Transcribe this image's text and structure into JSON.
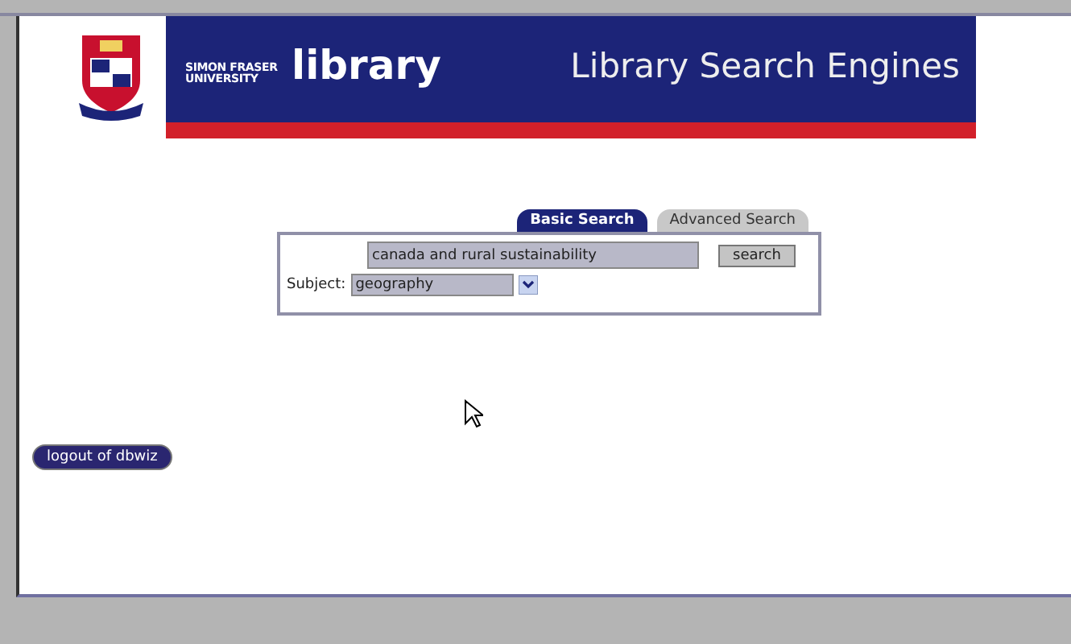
{
  "header": {
    "logo_small": "SIMON FRASER UNIVERSITY",
    "logo_word": "library",
    "title": "Library Search Engines"
  },
  "tabs": [
    {
      "label": "Basic Search",
      "selected": true
    },
    {
      "label": "Advanced Search",
      "selected": false
    }
  ],
  "search": {
    "value": "canada and rural sustainability",
    "button": "search"
  },
  "subject": {
    "label": "Subject:",
    "value": "geography"
  },
  "logout": "logout of dbwiz"
}
